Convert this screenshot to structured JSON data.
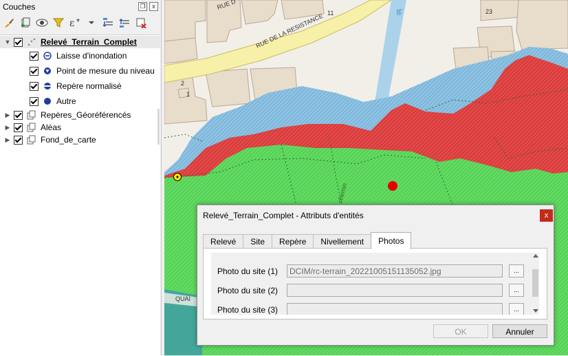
{
  "layers_panel": {
    "title": "Couches",
    "float_icon": "restore-icon",
    "close_glyph": "x",
    "toolbar_icons": [
      "style-brush-icon",
      "add-group-icon",
      "eye-visibility-icon",
      "filter-icon",
      "expression-filter-icon",
      "dropdown-arrow-icon",
      "expand-all-icon",
      "collapse-all-icon",
      "remove-layer-icon"
    ],
    "layers": [
      {
        "label": "Relevé_Terrain_Complet",
        "expanded": true,
        "checked": true,
        "bold": true
      },
      {
        "label": "Laisse d'inondation",
        "checked": true,
        "symbol": "circle-minus"
      },
      {
        "label": "Point de mesure du niveau",
        "checked": true,
        "symbol": "circle-triangle"
      },
      {
        "label": "Repère normalisé",
        "checked": true,
        "symbol": "circle-half"
      },
      {
        "label": "Autre",
        "checked": true,
        "symbol": "circle-filled"
      },
      {
        "label": "Repères_Géoréférencés",
        "expanded": false,
        "checked": true
      },
      {
        "label": "Aléas",
        "expanded": false,
        "checked": true
      },
      {
        "label": "Fond_de_carte",
        "expanded": false,
        "checked": true
      }
    ]
  },
  "map": {
    "street_labels": [
      "RUE DE LA RESISTANCE",
      "RUE D",
      "QUAI"
    ],
    "building_numbers": [
      "23",
      "11",
      "2",
      "1"
    ],
    "river_label": "le",
    "path_label": "chemin",
    "colors": {
      "blue_zone": "#7fb8dc",
      "red_zone": "#dc3c3c",
      "green_zone": "#5cd65c",
      "buildings": "#e8dccb",
      "road": "#f7f0a8",
      "point": "#e60000"
    }
  },
  "dialog": {
    "title": "Relevé_Terrain_Complet - Attributs d'entités",
    "close_glyph": "x",
    "tabs": [
      "Relevé",
      "Site",
      "Repère",
      "Nivellement",
      "Photos"
    ],
    "active_tab": "Photos",
    "fields": [
      {
        "label": "Photo du site (1)",
        "value": "DCIM/rc-terrain_20221005151135052.jpg",
        "button": "..."
      },
      {
        "label": "Photo du site (2)",
        "value": "",
        "button": "..."
      },
      {
        "label": "Photo du site (3)",
        "value": "",
        "button": "..."
      }
    ],
    "ok_label": "OK",
    "cancel_label": "Annuler"
  }
}
